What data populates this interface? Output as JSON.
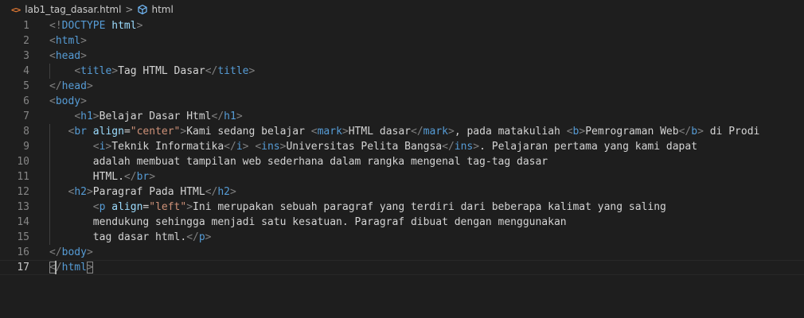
{
  "breadcrumb": {
    "file_icon": "<>",
    "file_name": "lab1_tag_dasar.html",
    "separator": ">",
    "symbol_icon": "html-element-icon",
    "symbol_name": "html"
  },
  "editor": {
    "current_line": 17,
    "lines": [
      {
        "n": "1",
        "tokens": [
          [
            "p",
            "<!"
          ],
          [
            "t",
            "DOCTYPE"
          ],
          [
            "x",
            " "
          ],
          [
            "a",
            "html"
          ],
          [
            "p",
            ">"
          ]
        ]
      },
      {
        "n": "2",
        "tokens": [
          [
            "p",
            "<"
          ],
          [
            "t",
            "html"
          ],
          [
            "p",
            ">"
          ]
        ]
      },
      {
        "n": "3",
        "tokens": [
          [
            "p",
            "<"
          ],
          [
            "t",
            "head"
          ],
          [
            "p",
            ">"
          ]
        ]
      },
      {
        "n": "4",
        "tokens": [
          [
            "x",
            "    "
          ],
          [
            "p",
            "<"
          ],
          [
            "t",
            "title"
          ],
          [
            "p",
            ">"
          ],
          [
            "x",
            "Tag HTML Dasar"
          ],
          [
            "p",
            "</"
          ],
          [
            "t",
            "title"
          ],
          [
            "p",
            ">"
          ]
        ]
      },
      {
        "n": "5",
        "tokens": [
          [
            "p",
            "</"
          ],
          [
            "t",
            "head"
          ],
          [
            "p",
            ">"
          ]
        ]
      },
      {
        "n": "6",
        "tokens": [
          [
            "p",
            "<"
          ],
          [
            "t",
            "body"
          ],
          [
            "p",
            ">"
          ]
        ]
      },
      {
        "n": "7",
        "tokens": [
          [
            "x",
            "    "
          ],
          [
            "p",
            "<"
          ],
          [
            "t",
            "h1"
          ],
          [
            "p",
            ">"
          ],
          [
            "x",
            "Belajar Dasar Html"
          ],
          [
            "p",
            "</"
          ],
          [
            "t",
            "h1"
          ],
          [
            "p",
            ">"
          ]
        ]
      },
      {
        "n": "8",
        "tokens": [
          [
            "x",
            "   "
          ],
          [
            "p",
            "<"
          ],
          [
            "t",
            "br"
          ],
          [
            "x",
            " "
          ],
          [
            "a",
            "align"
          ],
          [
            "x",
            "="
          ],
          [
            "s",
            "\"center\""
          ],
          [
            "p",
            ">"
          ],
          [
            "x",
            "Kami sedang belajar "
          ],
          [
            "p",
            "<"
          ],
          [
            "t",
            "mark"
          ],
          [
            "p",
            ">"
          ],
          [
            "x",
            "HTML dasar"
          ],
          [
            "p",
            "</"
          ],
          [
            "t",
            "mark"
          ],
          [
            "p",
            ">"
          ],
          [
            "x",
            ", pada matakuliah "
          ],
          [
            "p",
            "<"
          ],
          [
            "t",
            "b"
          ],
          [
            "p",
            ">"
          ],
          [
            "x",
            "Pemrograman Web"
          ],
          [
            "p",
            "</"
          ],
          [
            "t",
            "b"
          ],
          [
            "p",
            ">"
          ],
          [
            "x",
            " di Prodi"
          ]
        ]
      },
      {
        "n": "9",
        "tokens": [
          [
            "x",
            "       "
          ],
          [
            "p",
            "<"
          ],
          [
            "t",
            "i"
          ],
          [
            "p",
            ">"
          ],
          [
            "x",
            "Teknik Informatika"
          ],
          [
            "p",
            "</"
          ],
          [
            "t",
            "i"
          ],
          [
            "p",
            ">"
          ],
          [
            "x",
            " "
          ],
          [
            "p",
            "<"
          ],
          [
            "t",
            "ins"
          ],
          [
            "p",
            ">"
          ],
          [
            "x",
            "Universitas Pelita Bangsa"
          ],
          [
            "p",
            "</"
          ],
          [
            "t",
            "ins"
          ],
          [
            "p",
            ">"
          ],
          [
            "x",
            ". Pelajaran pertama yang kami dapat"
          ]
        ]
      },
      {
        "n": "10",
        "tokens": [
          [
            "x",
            "       adalah membuat tampilan web sederhana dalam rangka mengenal tag-tag dasar"
          ]
        ]
      },
      {
        "n": "11",
        "tokens": [
          [
            "x",
            "       HTML."
          ],
          [
            "p",
            "</"
          ],
          [
            "t",
            "br"
          ],
          [
            "p",
            ">"
          ]
        ]
      },
      {
        "n": "12",
        "tokens": [
          [
            "x",
            "   "
          ],
          [
            "p",
            "<"
          ],
          [
            "t",
            "h2"
          ],
          [
            "p",
            ">"
          ],
          [
            "x",
            "Paragraf Pada HTML"
          ],
          [
            "p",
            "</"
          ],
          [
            "t",
            "h2"
          ],
          [
            "p",
            ">"
          ]
        ]
      },
      {
        "n": "13",
        "tokens": [
          [
            "x",
            "       "
          ],
          [
            "p",
            "<"
          ],
          [
            "t",
            "p"
          ],
          [
            "x",
            " "
          ],
          [
            "a",
            "align"
          ],
          [
            "x",
            "="
          ],
          [
            "s",
            "\"left\""
          ],
          [
            "p",
            ">"
          ],
          [
            "x",
            "Ini merupakan sebuah paragraf yang terdiri dari beberapa kalimat yang saling"
          ]
        ]
      },
      {
        "n": "14",
        "tokens": [
          [
            "x",
            "       mendukung sehingga menjadi satu kesatuan. Paragraf dibuat dengan menggunakan"
          ]
        ]
      },
      {
        "n": "15",
        "tokens": [
          [
            "x",
            "       tag dasar html."
          ],
          [
            "p",
            "</"
          ],
          [
            "t",
            "p"
          ],
          [
            "p",
            ">"
          ]
        ]
      },
      {
        "n": "16",
        "tokens": [
          [
            "p",
            "</"
          ],
          [
            "t",
            "body"
          ],
          [
            "p",
            ">"
          ]
        ]
      },
      {
        "n": "17",
        "tokens": [
          [
            "pb",
            "<"
          ],
          [
            "p",
            "/"
          ],
          [
            "t",
            "html"
          ],
          [
            "pb",
            ">"
          ]
        ]
      }
    ]
  }
}
